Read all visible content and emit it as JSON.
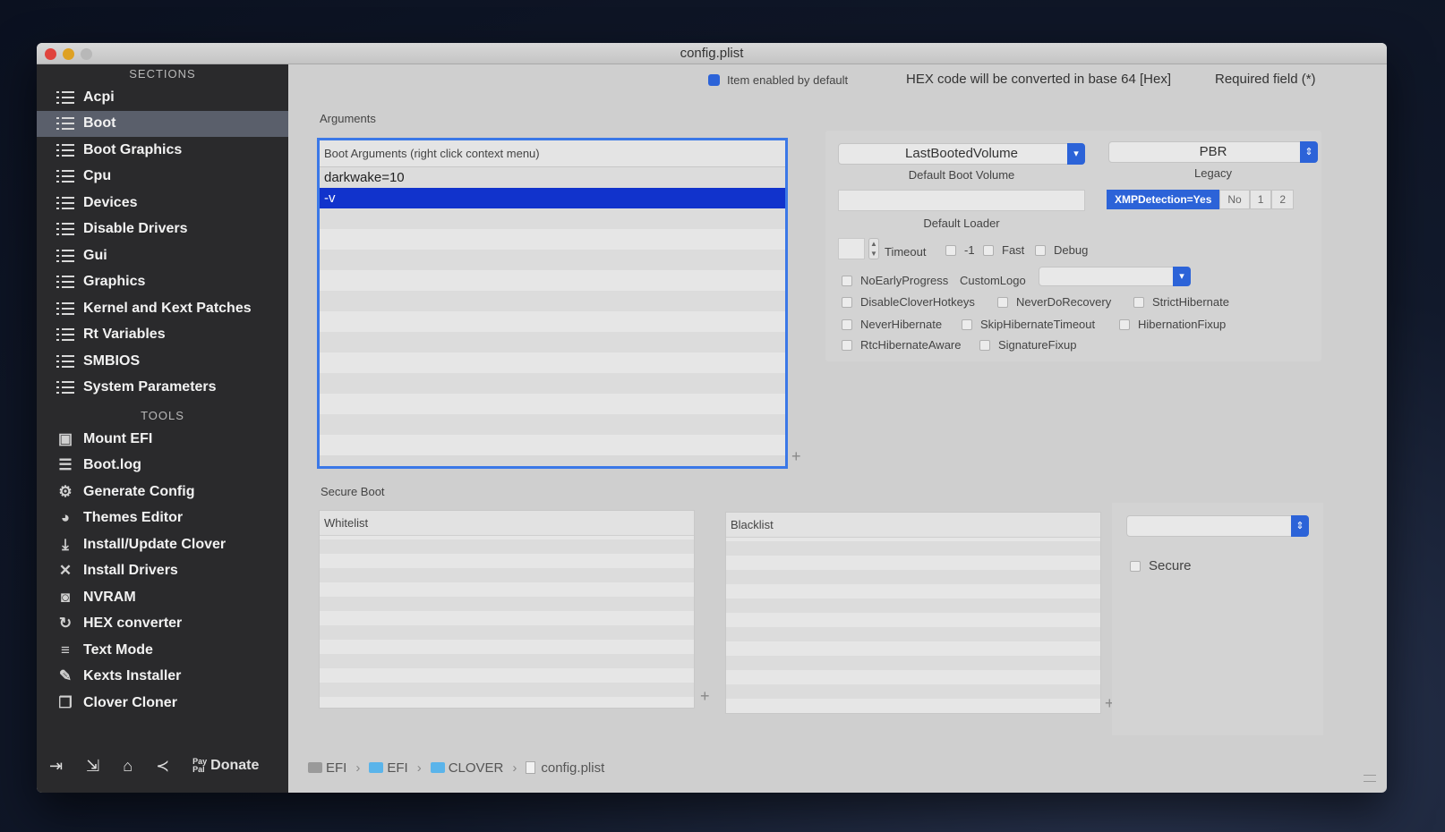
{
  "window": {
    "title": "config.plist"
  },
  "sidebar": {
    "sections_header": "SECTIONS",
    "sections": [
      {
        "label": "Acpi"
      },
      {
        "label": "Boot"
      },
      {
        "label": "Boot Graphics"
      },
      {
        "label": "Cpu"
      },
      {
        "label": "Devices"
      },
      {
        "label": "Disable Drivers"
      },
      {
        "label": "Gui"
      },
      {
        "label": "Graphics"
      },
      {
        "label": "Kernel and Kext Patches"
      },
      {
        "label": "Rt Variables"
      },
      {
        "label": "SMBIOS"
      },
      {
        "label": "System Parameters"
      }
    ],
    "selected_section": "Boot",
    "tools_header": "TOOLS",
    "tools": [
      {
        "label": "Mount EFI",
        "icon": "disk-icon"
      },
      {
        "label": "Boot.log",
        "icon": "log-icon"
      },
      {
        "label": "Generate Config",
        "icon": "gears-icon"
      },
      {
        "label": "Themes Editor",
        "icon": "palette-icon"
      },
      {
        "label": "Install/Update Clover",
        "icon": "download-icon"
      },
      {
        "label": "Install Drivers",
        "icon": "tools-icon"
      },
      {
        "label": "NVRAM",
        "icon": "chip-icon"
      },
      {
        "label": "HEX converter",
        "icon": "refresh-icon"
      },
      {
        "label": "Text Mode",
        "icon": "text-icon"
      },
      {
        "label": "Kexts Installer",
        "icon": "brush-icon"
      },
      {
        "label": "Clover Cloner",
        "icon": "copy-icon"
      }
    ],
    "footer": {
      "donate_small": "Pay Pal",
      "donate_label": "Donate"
    }
  },
  "topbar": {
    "item_enabled": "Item enabled by default",
    "hex_note": "HEX code will be converted in base 64 [Hex]",
    "required": "Required field (*)"
  },
  "arguments": {
    "section_label": "Arguments",
    "table_header": "Boot Arguments (right click context menu)",
    "rows": [
      "darkwake=10",
      "-v"
    ],
    "selected_row": "-v"
  },
  "boot": {
    "default_volume_value": "LastBootedVolume",
    "default_volume_label": "Default Boot Volume",
    "legacy_value": "PBR",
    "legacy_label": "Legacy",
    "default_loader_value": "",
    "default_loader_label": "Default Loader",
    "xmp_segments": [
      "XMPDetection=Yes",
      "No",
      "1",
      "2"
    ],
    "xmp_selected": "XMPDetection=Yes",
    "timeout_label": "Timeout",
    "checks": {
      "minus_one": "-1",
      "fast": "Fast",
      "debug": "Debug",
      "no_early_progress": "NoEarlyProgress",
      "custom_logo": "CustomLogo",
      "disable_clover_hotkeys": "DisableCloverHotkeys",
      "never_do_recovery": "NeverDoRecovery",
      "strict_hibernate": "StrictHibernate",
      "never_hibernate": "NeverHibernate",
      "skip_hibernate_timeout": "SkipHibernateTimeout",
      "hibernation_fixup": "HibernationFixup",
      "rtc_hibernate_aware": "RtcHibernateAware",
      "signature_fixup": "SignatureFixup"
    }
  },
  "secure_boot": {
    "section_label": "Secure Boot",
    "whitelist_header": "Whitelist",
    "blacklist_header": "Blacklist",
    "secure_label": "Secure"
  },
  "pathbar": {
    "items": [
      "EFI",
      "EFI",
      "CLOVER",
      "config.plist"
    ]
  },
  "colors": {
    "accent": "#2c63d8",
    "selection": "#1133cc",
    "sidebar": "#2a2a2c"
  }
}
